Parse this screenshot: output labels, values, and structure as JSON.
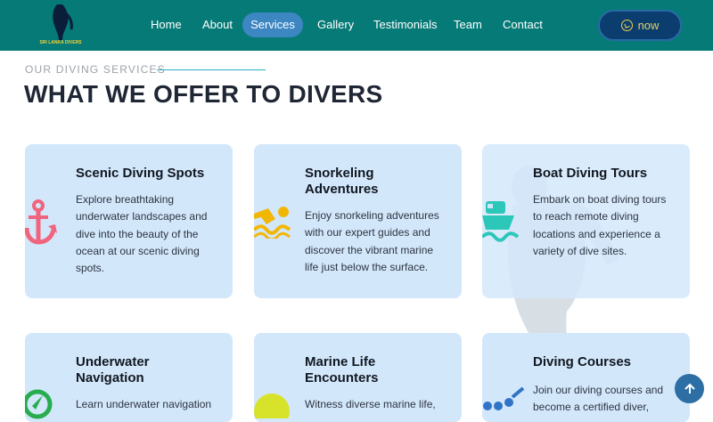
{
  "header": {
    "logo_text": "SRI LANKA DIVERS",
    "nav_items": [
      {
        "label": "Home",
        "active": false
      },
      {
        "label": "About",
        "active": false
      },
      {
        "label": "Services",
        "active": true
      },
      {
        "label": "Gallery",
        "active": false
      },
      {
        "label": "Testimonials",
        "active": false
      },
      {
        "label": "Team",
        "active": false
      },
      {
        "label": "Contact",
        "active": false
      }
    ],
    "cta_label": "now",
    "cta_icon": "whatsapp-icon"
  },
  "section": {
    "eyebrow": "OUR DIVING SERVICES",
    "title": "WHAT WE OFFER TO DIVERS"
  },
  "services": [
    {
      "title": "Scenic Diving Spots",
      "text": "Explore breathtaking underwater landscapes and dive into the beauty of the ocean at our scenic diving spots.",
      "icon": "anchor-icon",
      "icon_color": "#f0647e"
    },
    {
      "title": "Snorkeling Adventures",
      "text": "Enjoy snorkeling adventures with our expert guides and discover the vibrant marine life just below the surface.",
      "icon": "swimmer-icon",
      "icon_color": "#f2b705"
    },
    {
      "title": "Boat Diving Tours",
      "text": "Embark on boat diving tours to reach remote diving locations and experience a variety of dive sites.",
      "icon": "ship-icon",
      "icon_color": "#2cc7b9"
    },
    {
      "title": "Underwater Navigation",
      "text": "Learn underwater navigation",
      "icon": "compass-icon",
      "icon_color": "#27ad4f"
    },
    {
      "title": "Marine Life Encounters",
      "text": "Witness diverse marine life,",
      "icon": "fish-icon",
      "icon_color": "#d7e32a"
    },
    {
      "title": "Diving Courses",
      "text": "Join our diving courses and become a certified diver,",
      "icon": "graduation-icon",
      "icon_color": "#3173c7"
    }
  ],
  "colors": {
    "header_bg": "#067a77",
    "active_nav": "#3c86c2",
    "card_bg": "#d3e7fb",
    "cta_bg": "#0b3d6e",
    "scroll_top_bg": "#2d6ea5"
  },
  "scroll_top_icon": "arrow-up-icon"
}
